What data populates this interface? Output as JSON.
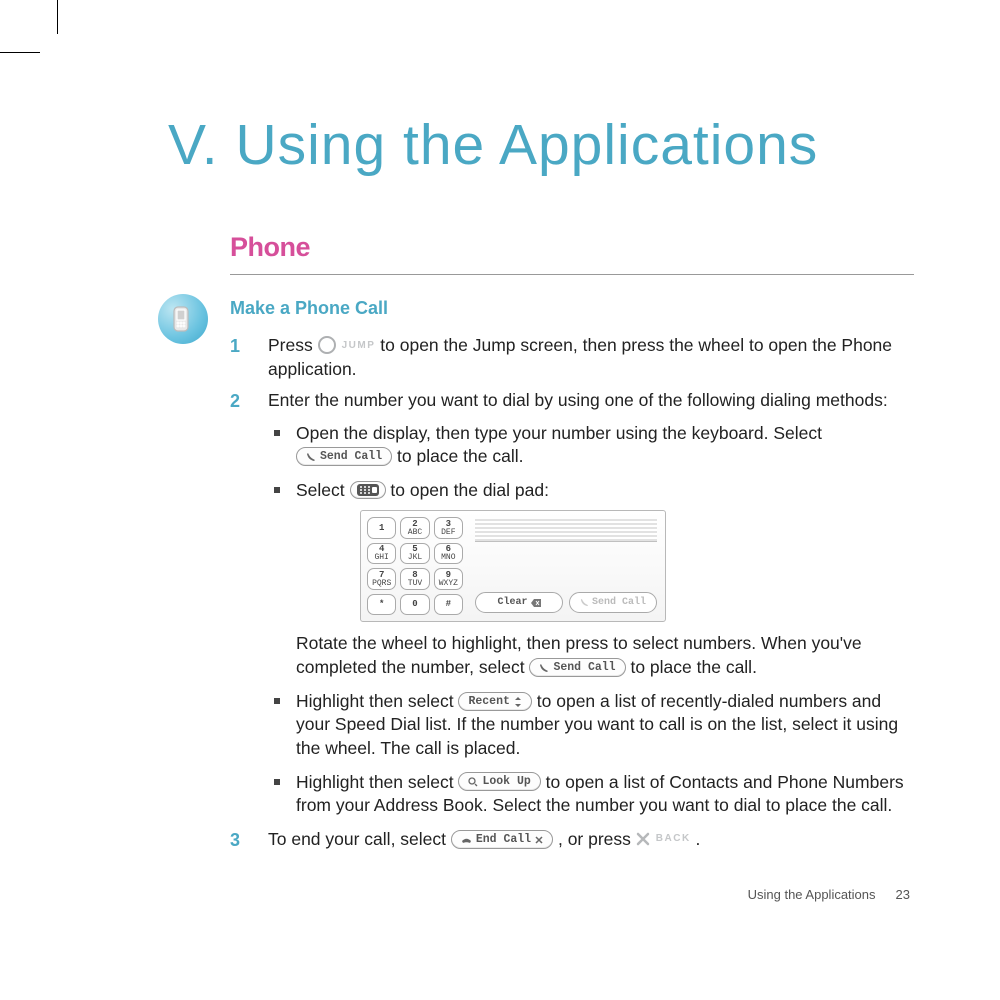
{
  "chapter": {
    "title": "V. Using the Applications"
  },
  "section": {
    "head": "Phone",
    "subhead": "Make a Phone Call"
  },
  "steps": {
    "1": {
      "num": "1",
      "pre": "Press ",
      "jump_label": "JUMP",
      "post": " to open the Jump screen, then press the wheel to open the Phone application."
    },
    "2": {
      "num": "2",
      "text": "Enter the number you want to dial by using one of the following dialing methods:"
    },
    "3": {
      "num": "3",
      "pre": "To end your call, select ",
      "post": ", or press ",
      "back_label": "BACK",
      "tail": " ."
    }
  },
  "bullets": {
    "a": {
      "pre": "Open the display, then type your number using the keyboard. Select ",
      "post": " to place the call."
    },
    "b": {
      "pre": "Select ",
      "post": " to open the dial pad:"
    },
    "c": {
      "pre": "Rotate the wheel to highlight, then press to select numbers. When you've completed the number, select ",
      "post": " to place the call."
    },
    "d": {
      "pre": "Highlight then select ",
      "post": " to open a list of recently-dialed numbers and your Speed Dial list. If the number you want to call is on the list, select it using the wheel. The call is placed."
    },
    "e": {
      "pre": "Highlight then select ",
      "post": " to open a list of Contacts and Phone Numbers from your Address Book. Select the number you want to dial to place the call."
    }
  },
  "buttons": {
    "send_call": "Send Call",
    "recent": "Recent",
    "look_up": "Look Up",
    "end_call": "End Call",
    "clear": "Clear",
    "dialpad_icon": "dialpad"
  },
  "dialpad": {
    "keys": [
      {
        "n": "1",
        "l": ""
      },
      {
        "n": "2",
        "l": "ABC"
      },
      {
        "n": "3",
        "l": "DEF"
      },
      {
        "n": "4",
        "l": "GHI"
      },
      {
        "n": "5",
        "l": "JKL"
      },
      {
        "n": "6",
        "l": "MNO"
      },
      {
        "n": "7",
        "l": "PQRS"
      },
      {
        "n": "8",
        "l": "TUV"
      },
      {
        "n": "9",
        "l": "WXYZ"
      },
      {
        "n": "*",
        "l": ""
      },
      {
        "n": "0",
        "l": ""
      },
      {
        "n": "#",
        "l": ""
      }
    ]
  },
  "footer": {
    "section": "Using the Applications",
    "page": "23"
  }
}
